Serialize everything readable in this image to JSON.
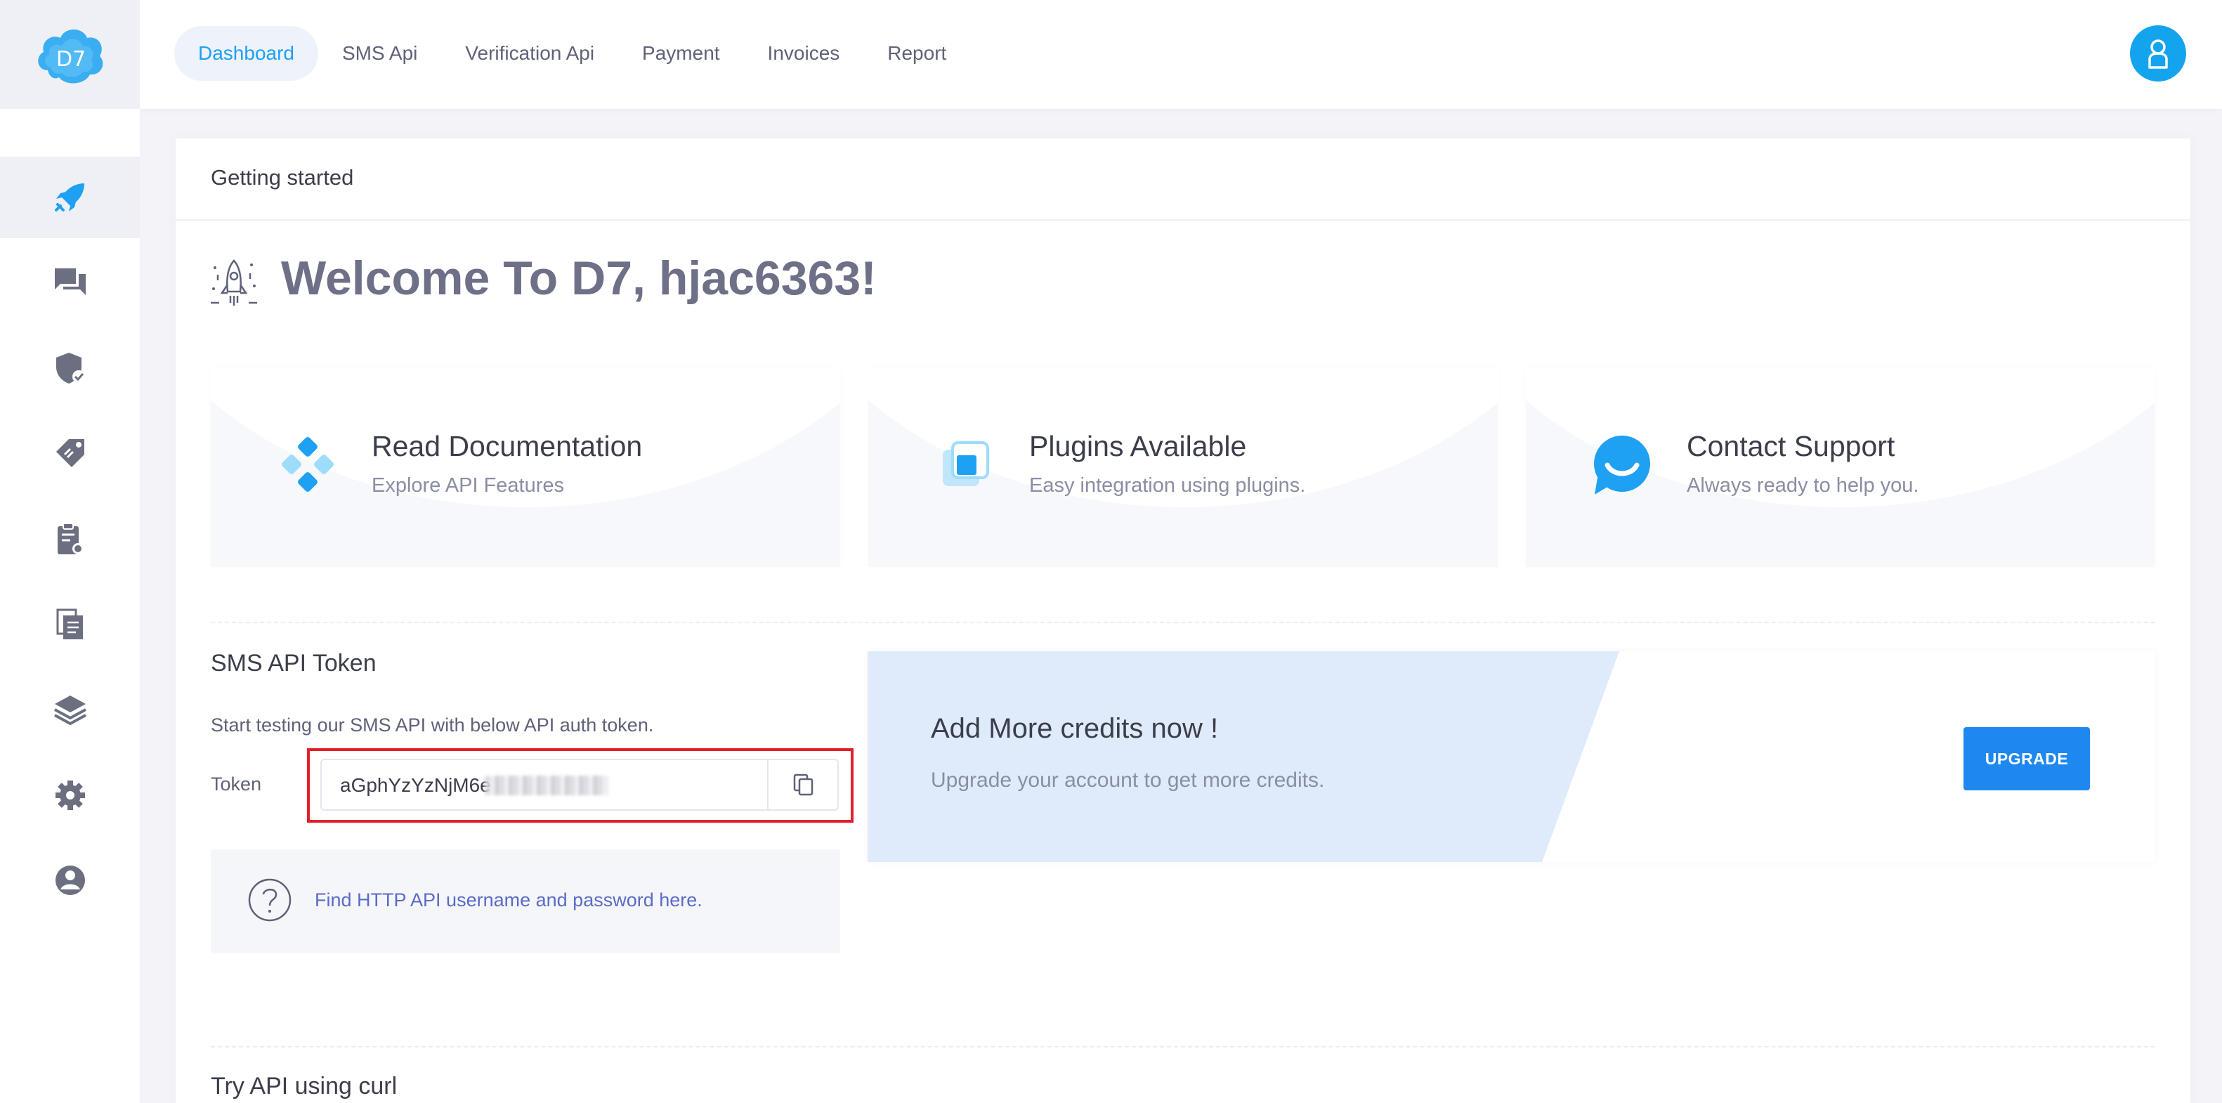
{
  "header": {
    "nav": [
      {
        "label": "Dashboard",
        "active": true
      },
      {
        "label": "SMS Api",
        "active": false
      },
      {
        "label": "Verification Api",
        "active": false
      },
      {
        "label": "Payment",
        "active": false
      },
      {
        "label": "Invoices",
        "active": false
      },
      {
        "label": "Report",
        "active": false
      }
    ],
    "logo_text": "D7",
    "avatar_icon": "user-icon"
  },
  "sidebar": {
    "items": [
      {
        "icon": "rocket-icon",
        "active": true
      },
      {
        "icon": "chat-icon",
        "active": false
      },
      {
        "icon": "shield-check-icon",
        "active": false
      },
      {
        "icon": "tag-icon",
        "active": false
      },
      {
        "icon": "clipboard-icon",
        "active": false
      },
      {
        "icon": "documents-icon",
        "active": false
      },
      {
        "icon": "layers-icon",
        "active": false
      },
      {
        "icon": "gear-icon",
        "active": false
      },
      {
        "icon": "support-icon",
        "active": false
      }
    ]
  },
  "main": {
    "card_title": "Getting started",
    "welcome": "Welcome To D7, hjac6363!",
    "features": [
      {
        "title": "Read Documentation",
        "subtitle": "Explore API Features",
        "icon": "documentation-icon"
      },
      {
        "title": "Plugins Available",
        "subtitle": "Easy integration using plugins.",
        "icon": "plugins-icon"
      },
      {
        "title": "Contact Support",
        "subtitle": "Always ready to help you.",
        "icon": "support-chat-icon"
      }
    ],
    "token_section": {
      "title": "SMS API Token",
      "description": "Start testing our SMS API with below API auth token.",
      "label": "Token",
      "value": "aGphYzYzNjM6e"
    },
    "help_link": "Find HTTP API username and password here.",
    "credits": {
      "title": "Add More credits now !",
      "subtitle": "Upgrade your account to get more credits.",
      "button": "UPGRADE"
    },
    "curl_title": "Try API using curl"
  },
  "colors": {
    "accent": "#1ea1f2",
    "upgrade_button": "#1e88f0",
    "highlight_outline": "#e0202b"
  }
}
